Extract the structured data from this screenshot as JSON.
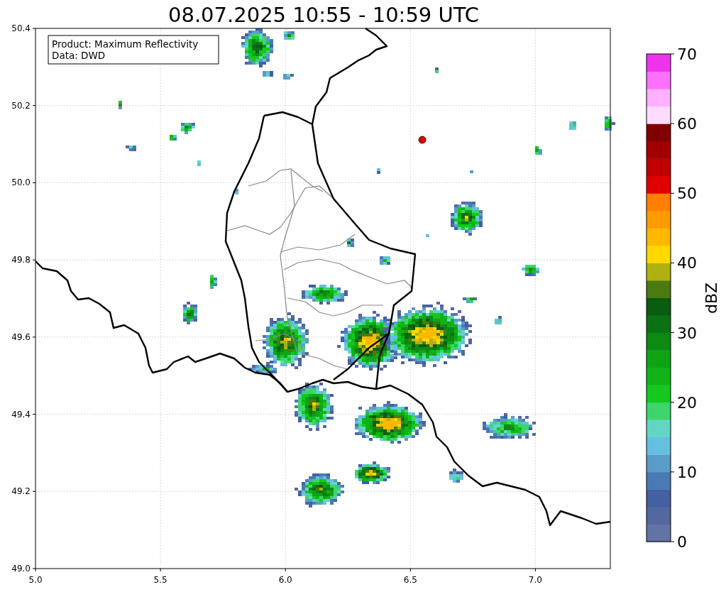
{
  "title": "08.07.2025 10:55 - 10:59 UTC",
  "info_box": {
    "lines": [
      "Product: Maximum Reflectivity",
      "Data: DWD"
    ]
  },
  "map": {
    "x_ticks": [
      "5.0",
      "5.5",
      "6.0",
      "6.5",
      "7.0"
    ],
    "y_ticks": [
      "50.4",
      "50.2",
      "50.0",
      "49.8",
      "49.6",
      "49.4",
      "49.2",
      "49.0"
    ]
  },
  "colorbar": {
    "label": "dBZ",
    "ticks": [
      "70",
      "60",
      "50",
      "40",
      "30",
      "20",
      "10",
      "0"
    ]
  }
}
